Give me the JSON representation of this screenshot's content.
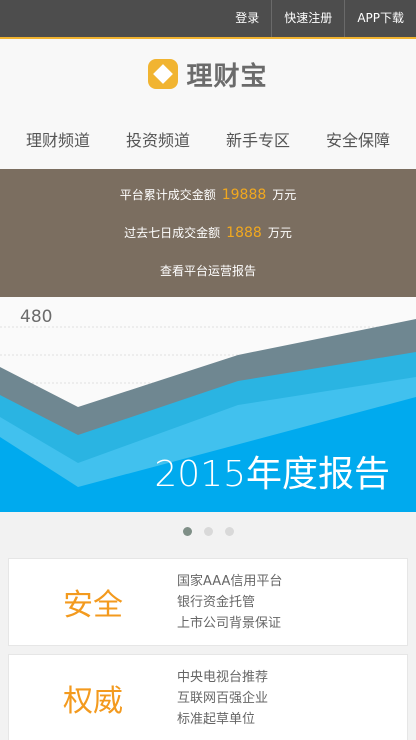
{
  "topbar": {
    "login": "登录",
    "register": "快速注册",
    "app": "APP下载"
  },
  "logo": {
    "text": "理财宝",
    "accent": "#f1b431"
  },
  "nav": [
    "理财频道",
    "投资频道",
    "新手专区",
    "安全保障"
  ],
  "stats": {
    "total_label": "平台累计成交金额",
    "total_value": "19888",
    "total_unit": "万元",
    "week_label": "过去七日成交金额",
    "week_value": "1888",
    "week_unit": "万元",
    "report_link": "查看平台运营报告"
  },
  "banner": {
    "value": "480",
    "title": "2015年度报告"
  },
  "carousel": {
    "count": 3,
    "active": 1
  },
  "cards": [
    {
      "title": "安全",
      "lines": [
        "国家AAA信用平台",
        "银行资金托管",
        "上市公司背景保证"
      ]
    },
    {
      "title": "权威",
      "lines": [
        "中央电视台推荐",
        "互联网百强企业",
        "标准起草单位"
      ]
    }
  ]
}
